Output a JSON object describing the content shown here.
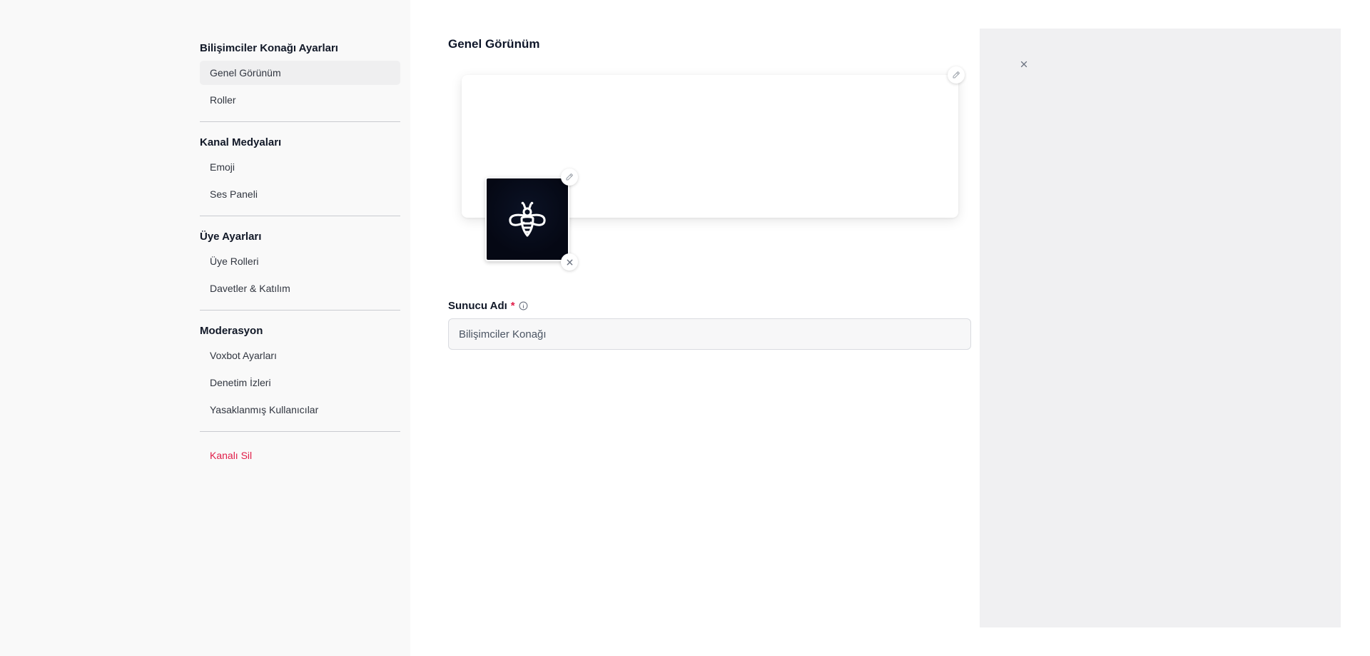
{
  "sidebar": {
    "sections": [
      {
        "title": "Bilişimciler Konağı Ayarları",
        "items": [
          {
            "label": "Genel Görünüm",
            "active": true
          },
          {
            "label": "Roller"
          }
        ]
      },
      {
        "title": "Kanal Medyaları",
        "items": [
          {
            "label": "Emoji"
          },
          {
            "label": "Ses Paneli"
          }
        ]
      },
      {
        "title": "Üye Ayarları",
        "items": [
          {
            "label": "Üye Rolleri"
          },
          {
            "label": "Davetler & Katılım"
          }
        ]
      },
      {
        "title": "Moderasyon",
        "items": [
          {
            "label": "Voxbot Ayarları"
          },
          {
            "label": "Denetim İzleri"
          },
          {
            "label": "Yasaklanmış Kullanıcılar"
          }
        ]
      }
    ],
    "danger_item": "Kanalı Sil"
  },
  "main": {
    "title": "Genel Görünüm",
    "server_name_label": "Sunucu Adı",
    "required_mark": "*",
    "server_name_value": "Bilişimciler Konağı"
  },
  "icons": {
    "banner_edit": "pencil-icon",
    "avatar_edit": "pencil-icon",
    "avatar_remove": "close-icon",
    "avatar_logo": "bee-icon",
    "info": "info-icon",
    "panel_close": "close-icon"
  },
  "colors": {
    "danger": "#e11d48",
    "sidebar_bg": "#f9f9f9",
    "active_item_bg": "#efeff0",
    "panel_bg": "#f0f0f2"
  }
}
